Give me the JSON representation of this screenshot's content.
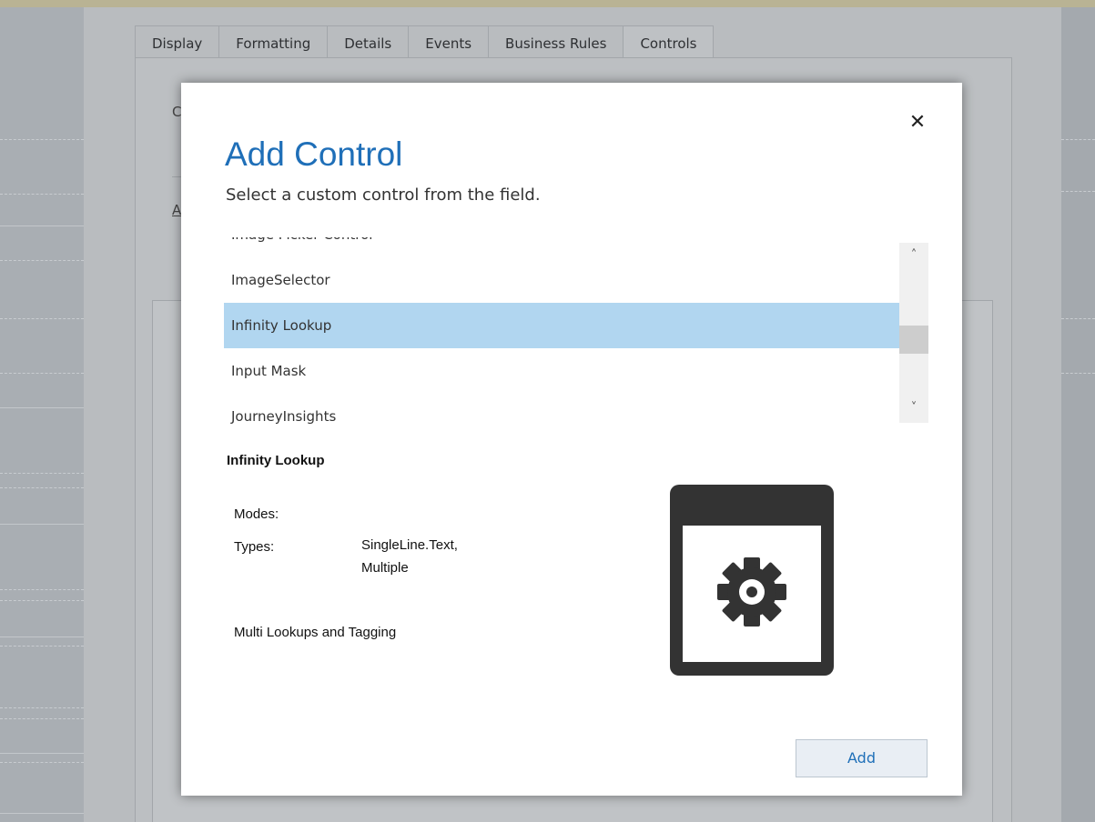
{
  "background": {
    "tabs": [
      {
        "label": "Display"
      },
      {
        "label": "Formatting"
      },
      {
        "label": "Details"
      },
      {
        "label": "Events"
      },
      {
        "label": "Business Rules"
      },
      {
        "label": "Controls",
        "active": true
      }
    ],
    "partial_label_1": "C",
    "partial_link_1": "A"
  },
  "dialog": {
    "title": "Add Control",
    "subtitle": "Select a custom control from the field.",
    "close_icon": "close-icon",
    "controls": [
      {
        "label": "Image Picker Control"
      },
      {
        "label": "ImageSelector"
      },
      {
        "label": "Infinity Lookup",
        "selected": true
      },
      {
        "label": "Input Mask"
      },
      {
        "label": "JourneyInsights"
      }
    ],
    "details": {
      "name": "Infinity Lookup",
      "modes_label": "Modes:",
      "modes_value": "",
      "types_label": "Types:",
      "types_value_line1": "SingleLine.Text,",
      "types_value_line2": "Multiple",
      "description": "Multi Lookups and Tagging",
      "preview_icon": "custom-control-gear-icon"
    },
    "add_button_label": "Add"
  },
  "colors": {
    "title_blue": "#1f6fb8",
    "selected_row": "#b1d6f0",
    "icon_dark": "#333333"
  }
}
